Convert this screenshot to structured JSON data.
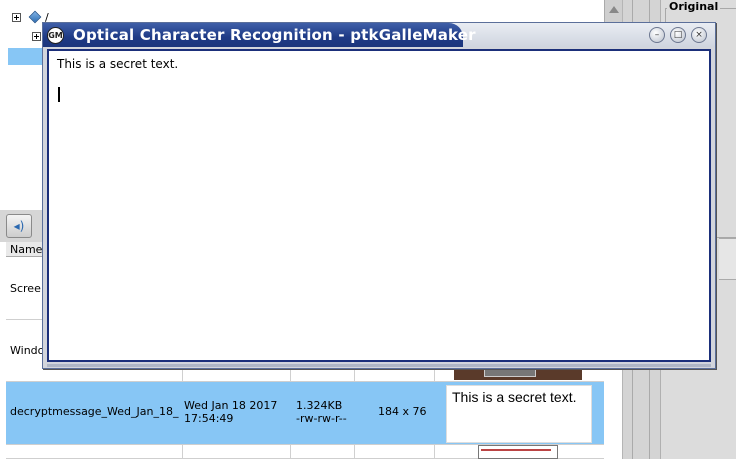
{
  "background": {
    "tree": {
      "items": [
        {
          "label": "/"
        },
        {
          "label": ""
        }
      ]
    },
    "right_panel": {
      "label": "Original"
    },
    "list": {
      "header_name": "Name",
      "rows": [
        {
          "name": "Scree"
        },
        {
          "name": "Windo"
        },
        {
          "name": "decryptmessage_Wed_Jan_18_",
          "date_line1": "Wed Jan 18  2017",
          "date_line2": "17:54:49",
          "size": "1.324KB",
          "perms": "-rw-rw-r--",
          "dims": "184 x 76",
          "thumb_text": "This is a secret text."
        }
      ]
    }
  },
  "dialog": {
    "title": "Optical Character Recognition - ptkGalleMaker",
    "app_icon_text": "GM",
    "text": "This is a secret text.",
    "controls": {
      "minimize_glyph": "–",
      "maximize_glyph": "□",
      "close_glyph": "×"
    }
  }
}
